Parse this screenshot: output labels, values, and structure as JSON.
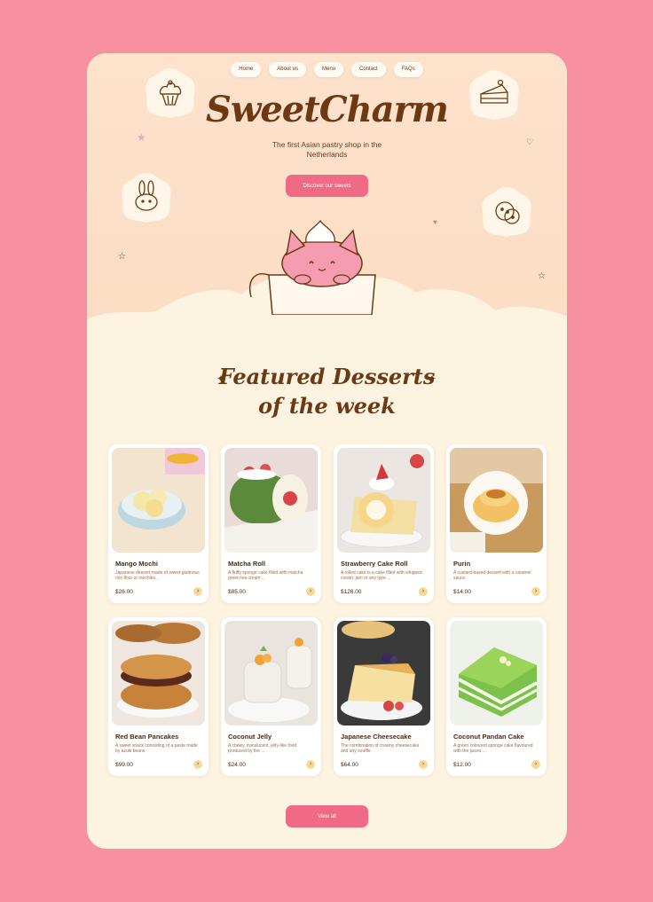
{
  "nav": {
    "items": [
      "Home",
      "About us",
      "Menu",
      "Contact",
      "FAQs"
    ]
  },
  "hero": {
    "brand": "SweetCharm",
    "tagline": "The first Asian pastry shop in the Netherlands",
    "cta_label": "Discover our sweets"
  },
  "section": {
    "title_line1": "Featured Desserts",
    "title_line2": "of the week"
  },
  "desserts": [
    {
      "name": "Mango Mochi",
      "desc": "Japanese dessert made of sweet glutinous rice flour or mochiko...",
      "price": "$26.00"
    },
    {
      "name": "Matcha Roll",
      "desc": "A fluffy sponge cake filled with matcha green tea cream ...",
      "price": "$85.00"
    },
    {
      "name": "Strawberry Cake Roll",
      "desc": "A rolled cake is a cake filled with whipped cream, jam or any type ...",
      "price": "$126.00"
    },
    {
      "name": "Purin",
      "desc": "A custard-based dessert with a caramel sauce",
      "price": "$14.00"
    },
    {
      "name": "Red Bean Pancakes",
      "desc": "A sweet snack consisting of a paste made by azuki beans",
      "price": "$99.00"
    },
    {
      "name": "Coconut Jelly",
      "desc": "A chewy, translucent, jelly-like food produced by the ...",
      "price": "$24.00"
    },
    {
      "name": "Japanese Cheesecake",
      "desc": "The combination of creamy cheesecake and airy souffle",
      "price": "$64.00"
    },
    {
      "name": "Coconut Pandan Cake",
      "desc": "A green coloured sponge cake flavoured with the juices ...",
      "price": "$12.00"
    }
  ],
  "view_all_label": "View all",
  "colors": {
    "background": "#f7919f",
    "page": "#fdf3e1",
    "accent": "#f06a86",
    "brand_brown": "#6b3a14"
  },
  "icons": {
    "decor": [
      "cupcake-icon",
      "cake-slice-icon",
      "bunny-icon",
      "cookie-icon",
      "cat-in-cup-icon",
      "heart-icon",
      "star-icon",
      "sparkle-icon"
    ],
    "card_arrow": "chevron-right-icon"
  }
}
